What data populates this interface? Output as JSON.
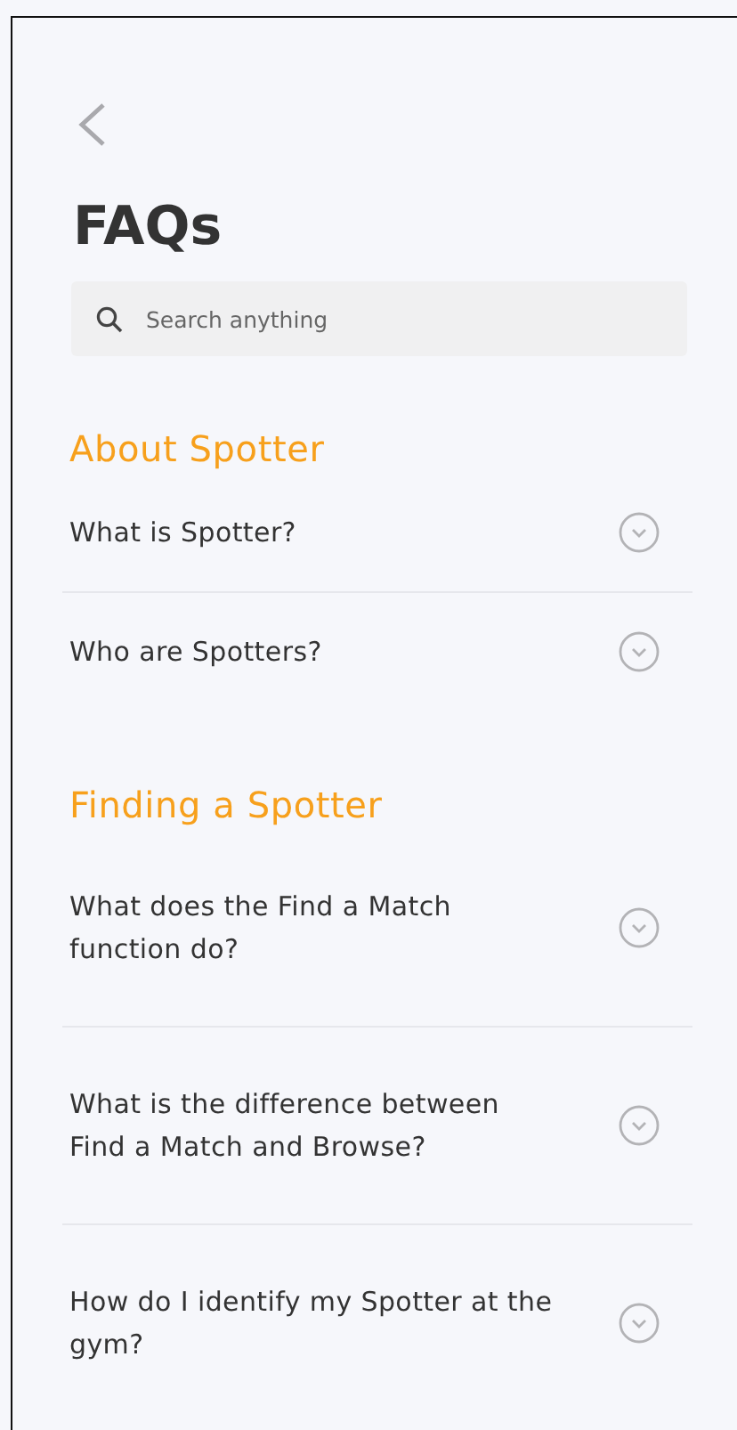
{
  "search": {
    "placeholder": "Search anything"
  },
  "title": "FAQs",
  "sections": [
    {
      "heading": "About Spotter",
      "items": [
        {
          "question": "What is Spotter?",
          "expanded": false
        },
        {
          "question": "Who are Spotters?",
          "expanded": false
        }
      ]
    },
    {
      "heading": "Finding a Spotter",
      "items": [
        {
          "question": "What does the Find a Match function do?",
          "expanded": false
        },
        {
          "question": "What is the difference between Find a Match and Browse?",
          "expanded": false
        },
        {
          "question": "How do I identify my Spotter at the gym?",
          "expanded": false
        }
      ]
    }
  ]
}
